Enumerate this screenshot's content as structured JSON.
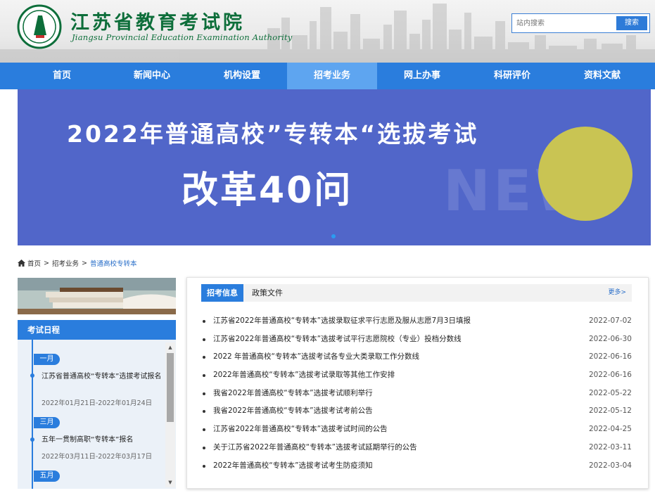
{
  "header": {
    "title": "江苏省教育考试院",
    "subtitle": "Jiangsu Provincial Education Examination Authority",
    "search_placeholder": "站内搜索",
    "search_button": "搜索"
  },
  "nav": {
    "items": [
      {
        "label": "首页",
        "active": false
      },
      {
        "label": "新闻中心",
        "active": false
      },
      {
        "label": "机构设置",
        "active": false
      },
      {
        "label": "招考业务",
        "active": true
      },
      {
        "label": "网上办事",
        "active": false
      },
      {
        "label": "科研评价",
        "active": false
      },
      {
        "label": "资料文献",
        "active": false
      }
    ]
  },
  "banner": {
    "line1": "2022年普通高校”专转本“选拔考试",
    "line2": "改革40问",
    "watermark": "NEW",
    "colors": {
      "background": "#5166c9",
      "circle": "#c9c453"
    }
  },
  "breadcrumb": {
    "items": [
      "首页",
      "招考业务",
      "普通高校专转本"
    ],
    "separator": ">"
  },
  "schedule": {
    "heading": "考试日程",
    "entries": [
      {
        "month": "一月",
        "title": "江苏省普通高校“专转本”选拔考试报名",
        "dates": "2022年01月21日-2022年01月24日"
      },
      {
        "month": "三月",
        "title": "五年一贯制高职“专转本”报名",
        "dates": "2022年03月11日-2022年03月17日"
      },
      {
        "month": "五月",
        "title": "",
        "dates": ""
      }
    ]
  },
  "news": {
    "tabs": [
      "招考信息",
      "政策文件"
    ],
    "more": "更多>",
    "items": [
      {
        "title": "江苏省2022年普通高校“专转本”选拔录取征求平行志愿及服从志愿7月3日填报",
        "date": "2022-07-02"
      },
      {
        "title": "江苏省2022年普通高校“专转本”选拔考试平行志愿院校（专业）投档分数线",
        "date": "2022-06-30"
      },
      {
        "title": "2022 年普通高校“专转本”选拔考试各专业大类录取工作分数线",
        "date": "2022-06-16"
      },
      {
        "title": "2022年普通高校“专转本”选拔考试录取等其他工作安排",
        "date": "2022-06-16"
      },
      {
        "title": "我省2022年普通高校“专转本”选拔考试顺利举行",
        "date": "2022-05-22"
      },
      {
        "title": "我省2022年普通高校“专转本”选拔考试考前公告",
        "date": "2022-05-12"
      },
      {
        "title": "江苏省2022年普通高校“专转本”选拔考试时间的公告",
        "date": "2022-04-25"
      },
      {
        "title": "关于江苏省2022年普通高校“专转本”选拔考试延期举行的公告",
        "date": "2022-03-11"
      },
      {
        "title": "2022年普通高校“专转本”选拔考试考生防疫须知",
        "date": "2022-03-04"
      }
    ]
  },
  "colors": {
    "brand_blue": "#2a7ddd",
    "nav_active": "#5ea5f0",
    "logo_green": "#0d6e3a"
  }
}
